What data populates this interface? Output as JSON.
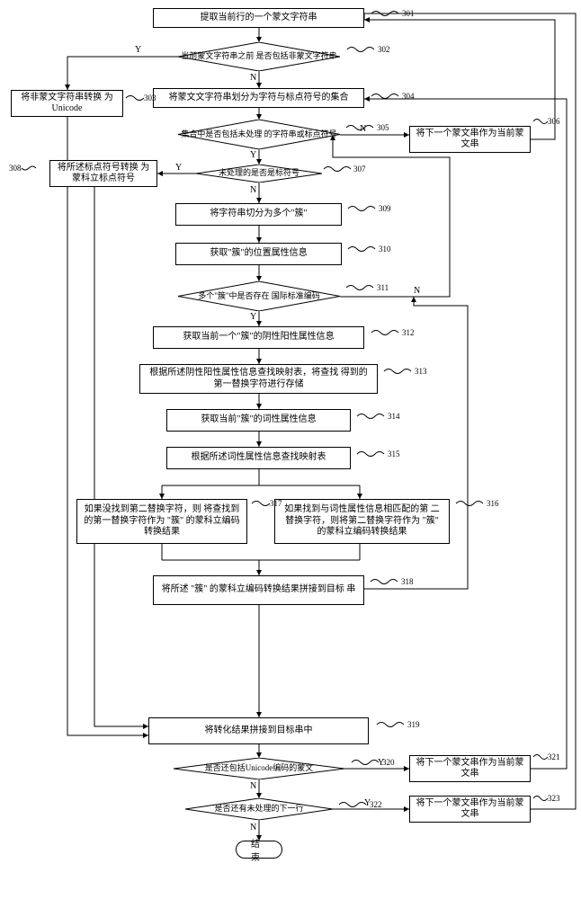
{
  "nodes": {
    "n301": "提取当前行的一个蒙文字符串",
    "d302": "当前蒙文字符串之前 是否包括非蒙文字符串",
    "n303": "将非蒙文字符串转换 为Unicode",
    "n304": "将蒙文文字符串划分为字符与标点符号的集合",
    "d305": "集合中是否包括未处理 的字符串或标点符号",
    "n306": "将下一个蒙文串作为当前蒙 文串",
    "d307": "未处理的是否是标符号",
    "n308": "将所述标点符号转换 为蒙科立标点符号",
    "n309": "将字符串切分为多个\"簇\"",
    "n310": "获取\"簇\"的位置属性信息",
    "d311": "多个\"簇\"中是否存在 国际标准编码",
    "n312": "获取当前一个\"簇\"的阴性阳性属性信息",
    "n313": "根据所述阴性阳性属性信息查找映射表，将查找 得到的第一替换字符进行存储",
    "n314": "获取当前\"簇\"的词性属性信息",
    "n315": "根据所述词性属性信息查找映射表",
    "n316": "如果找到与词性属性信息相匹配的第 二替换字符，则将第二替换字符作为 \"簇\" 的蒙科立编码转换结果",
    "n317": "如果没找到第二替换字符，则 将查找到的第一替换字符作为 \"簇\" 的蒙科立编码转换结果",
    "n318": "将所述 \"簇\" 的蒙科立编码转换结果拼接到目标 串",
    "n319": "将转化结果拼接到目标串中",
    "d320": "是否还包括Unicode编码的蒙文",
    "n321": "将下一个蒙文串作为当前蒙 文串",
    "d322": "是否还有未处理的下一行",
    "n323": "将下一个蒙文串作为当前蒙 文串",
    "end": "结束"
  },
  "labels": {
    "s301": "301",
    "s302": "302",
    "s303": "303",
    "s304": "304",
    "s305": "305",
    "s306": "306",
    "s307": "307",
    "s308": "308",
    "s309": "309",
    "s310": "310",
    "s311": "311",
    "s312": "312",
    "s313": "313",
    "s314": "314",
    "s315": "315",
    "s316": "316",
    "s317": "317",
    "s318": "318",
    "s319": "319",
    "s320": "320",
    "s321": "321",
    "s322": "322",
    "s323": "323",
    "Y": "Y",
    "N": "N"
  }
}
